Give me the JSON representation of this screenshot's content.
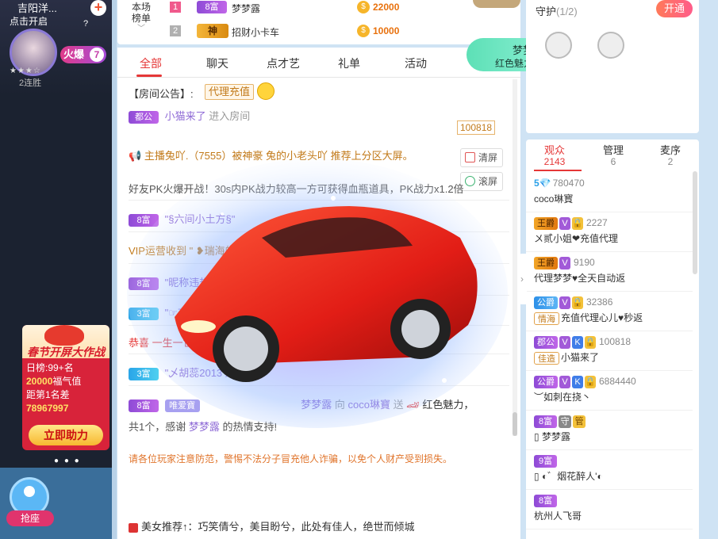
{
  "left": {
    "anchor_name": "吉阳洋...",
    "click_open": "点击开启",
    "help_mark": "?",
    "streak": "2连胜",
    "fire_label": "火爆",
    "fire_count": "7",
    "festival": {
      "title": "春节开屏大作战",
      "day_rank_label": "日榜:99+名",
      "blessing_value": "20000",
      "blessing_label": "福气值",
      "gap_label": "距第1名差",
      "gap_value": "78967997",
      "help_button": "立即助力"
    },
    "seat_button": "抢座"
  },
  "rank": {
    "label_line1": "本场",
    "label_line2": "榜单",
    "rows": [
      {
        "num": "1",
        "badge": "8富",
        "name": "梦梦露",
        "value": "22000"
      },
      {
        "num": "2",
        "badge": "神",
        "name": "招财小卡车",
        "value": "10000"
      }
    ]
  },
  "chat": {
    "tabs": [
      "全部",
      "聊天",
      "点才艺",
      "礼单",
      "活动"
    ],
    "announce_label": "【房间公告】:",
    "recharge_tag": "代理充值",
    "messages": {
      "m1_badge": "都公",
      "m1_user": "小猫来了",
      "m1_text": "进入房间",
      "m1_number": "100818",
      "m2_text": "主播兔吖.（7555）被神豪 兔的小老头吖 推荐上分区大屏。",
      "m3_text": "好友PK火爆开战！30s内PK战力较高一方可获得血瓶道具，PK战力x1.2倍",
      "m4_badge": "8富",
      "m4_user": "\"§六间小土方§\"",
      "m5_text": "VIP运营收到 \" ❥瑞海的邀请",
      "m6_badge": "8富",
      "m6_user": "\"昵称违规",
      "m7_badge": "3富",
      "m7_user": "\"☞有宝",
      "m8_text": "恭喜 一生一世",
      "m9_badge": "3富",
      "m9_user": "\"乄胡蕊2013 进入",
      "m10_badge": "8富",
      "m10_vip": "唯爱寶",
      "m10_from": "梦梦露",
      "m10_to": "coco琳寶",
      "m10_gift": "红色魅力，",
      "m10_line2_a": "共1个，感谢",
      "m10_line2_user": "梦梦露",
      "m10_line2_b": "的热情支持!"
    },
    "clear_button": "清屏",
    "scroll_button": "滚屏",
    "warning": "请各位玩家注意防范，警惕不法分子冒充他人诈骗，以免个人财产受到损失。",
    "recommend": "美女推荐↑：巧笑倩兮，美目盼兮，此处有佳人，绝世而倾城"
  },
  "gift_notice": {
    "user": "梦梦露",
    "gift": "红色魅力",
    "count": "1",
    "unit": "个"
  },
  "guard": {
    "title": "守护",
    "count": "(1/2)",
    "open_button": "开通"
  },
  "audience": {
    "tabs": [
      {
        "label": "观众",
        "count": "2143"
      },
      {
        "label": "管理",
        "count": "6"
      },
      {
        "label": "麦序",
        "count": "2"
      }
    ],
    "items": [
      {
        "tags": [
          "5💎"
        ],
        "id": "780470",
        "name": "coco琳寳"
      },
      {
        "tags": [
          "王爵",
          "V",
          "🔒"
        ],
        "id": "2227",
        "name": "〤贰小姐❤充值代理"
      },
      {
        "tags": [
          "王爵",
          "V"
        ],
        "id": "9190",
        "name": "代理梦梦♥全天自动返"
      },
      {
        "tags": [
          "公爵",
          "V",
          "🔒"
        ],
        "id": "32386",
        "name": "充值代理心儿♥秒返",
        "sub": "情海"
      },
      {
        "tags": [
          "郡公",
          "V",
          "K",
          "🔒"
        ],
        "id": "100818",
        "name": "小猫来了",
        "sub": "佳造"
      },
      {
        "tags": [
          "公爵",
          "V",
          "K",
          "🔒"
        ],
        "id": "6884440",
        "name": "︶如刺在挠丶"
      },
      {
        "tags": [
          "8富",
          "守",
          "管"
        ],
        "id": "",
        "name": "梦梦露"
      },
      {
        "tags": [
          "9富"
        ],
        "id": "",
        "name": "◐゛烟花醉人'◐"
      },
      {
        "tags": [
          "8富"
        ],
        "id": "",
        "name": "杭州人飞哥"
      }
    ]
  },
  "colors": {
    "accent_red": "#e53737",
    "coin_orange": "#e8710d",
    "rich_purple": "#8e4bd6",
    "warning_orange": "#e0742b"
  }
}
